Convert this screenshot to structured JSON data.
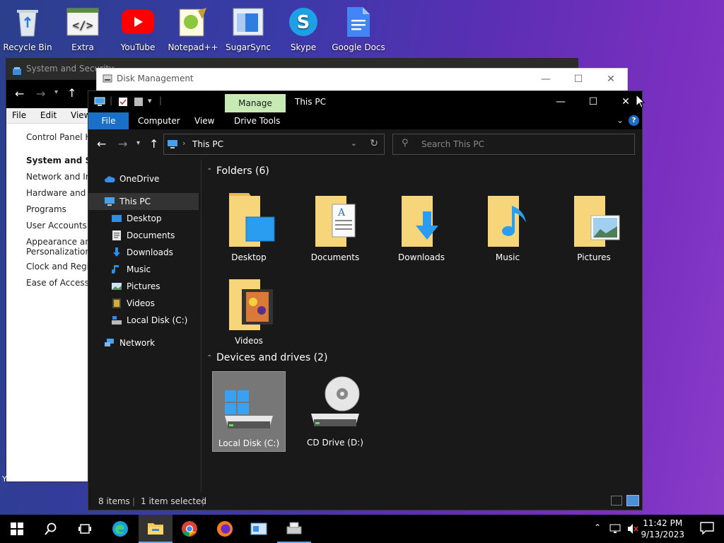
{
  "desktop": {
    "icons": [
      {
        "label": "Recycle Bin"
      },
      {
        "label": "Extra"
      },
      {
        "label": "YouTube"
      },
      {
        "label": "Notepad++"
      },
      {
        "label": "SugarSync"
      },
      {
        "label": "Skype"
      },
      {
        "label": "Google Docs"
      }
    ]
  },
  "control_panel": {
    "title": "System and Security",
    "menu": [
      "File",
      "Edit",
      "View"
    ],
    "links": [
      "Control Panel Home",
      "System and Security",
      "Network and Internet",
      "Hardware and Sound",
      "Programs",
      "User Accounts",
      "Appearance and Personalization",
      "Clock and Region",
      "Ease of Access"
    ],
    "bottom_text": "Youtube Ch...  Store - E"
  },
  "disk_management": {
    "title": "Disk Management"
  },
  "explorer": {
    "manage_tab": "Manage",
    "title": "This PC",
    "ribbon": {
      "file": "File",
      "computer": "Computer",
      "view": "View",
      "drive_tools": "Drive Tools"
    },
    "address": "This PC",
    "search_placeholder": "Search This PC",
    "sidebar": [
      {
        "label": "OneDrive",
        "icon": "cloud-icon"
      },
      {
        "label": "This PC",
        "icon": "computer-icon"
      },
      {
        "label": "Desktop",
        "icon": "desktop-icon"
      },
      {
        "label": "Documents",
        "icon": "documents-icon"
      },
      {
        "label": "Downloads",
        "icon": "downloads-icon"
      },
      {
        "label": "Music",
        "icon": "music-icon"
      },
      {
        "label": "Pictures",
        "icon": "pictures-icon"
      },
      {
        "label": "Videos",
        "icon": "videos-icon"
      },
      {
        "label": "Local Disk (C:)",
        "icon": "drive-icon"
      },
      {
        "label": "Network",
        "icon": "network-icon"
      }
    ],
    "folders_header": "Folders (6)",
    "folders": [
      "Desktop",
      "Documents",
      "Downloads",
      "Music",
      "Pictures",
      "Videos"
    ],
    "devices_header": "Devices and drives (2)",
    "devices": [
      "Local Disk (C:)",
      "CD Drive (D:)"
    ],
    "status": {
      "items": "8 items",
      "selected": "1 item selected"
    }
  },
  "taskbar": {
    "time": "11:42 PM",
    "date": "9/13/2023"
  },
  "colors": {
    "file_tab": "#1a6fc6",
    "manage_tab": "#c7e9b4",
    "folder": "#f2c85a",
    "accent": "#0078d7"
  }
}
